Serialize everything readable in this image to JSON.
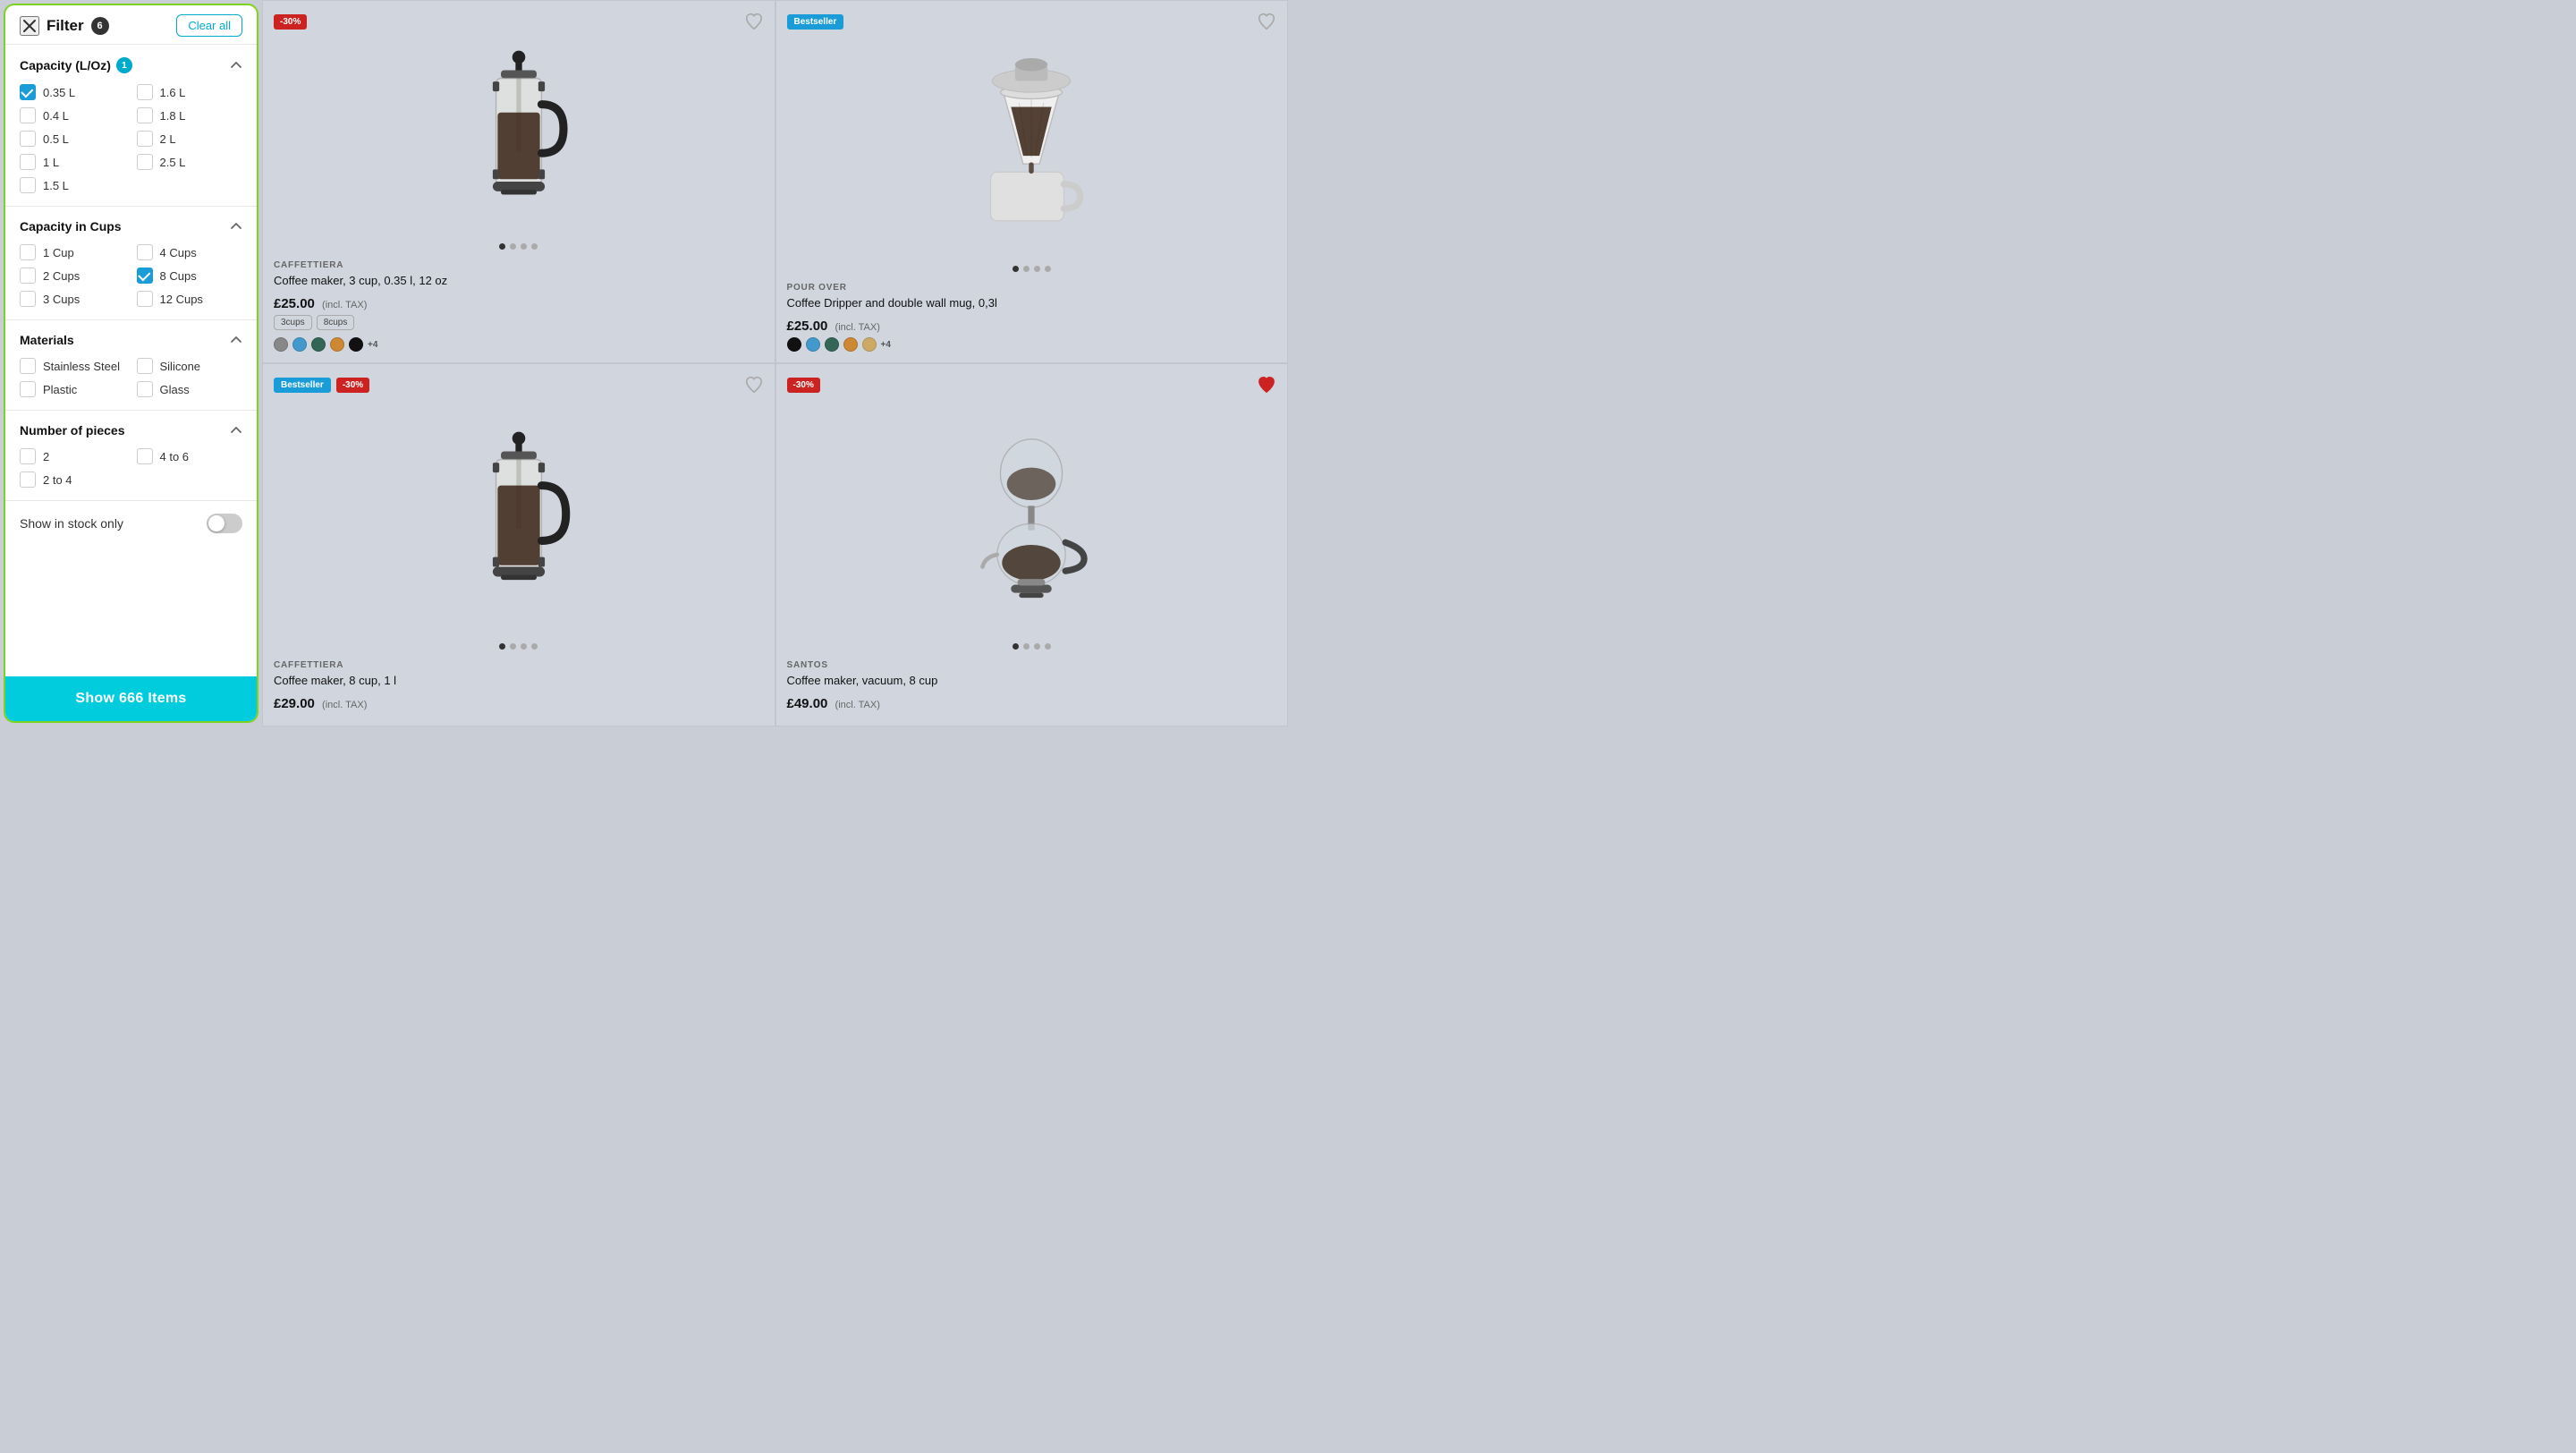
{
  "filter": {
    "title": "Filter",
    "badge": "6",
    "clear_all": "Clear all",
    "sections": [
      {
        "id": "capacity_l_oz",
        "title": "Capacity (L/Oz)",
        "badge": "1",
        "expanded": true,
        "options": [
          {
            "label": "0.35 L",
            "checked": true,
            "col": 0
          },
          {
            "label": "0.4 L",
            "checked": false,
            "col": 0
          },
          {
            "label": "0.5 L",
            "checked": false,
            "col": 0
          },
          {
            "label": "1 L",
            "checked": false,
            "col": 0
          },
          {
            "label": "1.5 L",
            "checked": false,
            "col": 0
          },
          {
            "label": "1.6 L",
            "checked": false,
            "col": 1
          },
          {
            "label": "1.8 L",
            "checked": false,
            "col": 1
          },
          {
            "label": "2 L",
            "checked": false,
            "col": 1
          },
          {
            "label": "2.5 L",
            "checked": false,
            "col": 1
          }
        ]
      },
      {
        "id": "capacity_cups",
        "title": "Capacity in Cups",
        "badge": null,
        "expanded": true,
        "options": [
          {
            "label": "1 Cup",
            "checked": false,
            "col": 0
          },
          {
            "label": "2 Cups",
            "checked": false,
            "col": 0
          },
          {
            "label": "3 Cups",
            "checked": false,
            "col": 0
          },
          {
            "label": "4 Cups",
            "checked": false,
            "col": 1
          },
          {
            "label": "8 Cups",
            "checked": true,
            "col": 1
          },
          {
            "label": "12 Cups",
            "checked": false,
            "col": 1
          }
        ]
      },
      {
        "id": "materials",
        "title": "Materials",
        "badge": null,
        "expanded": true,
        "options": [
          {
            "label": "Stainless Steel",
            "checked": false,
            "col": 0
          },
          {
            "label": "Plastic",
            "checked": false,
            "col": 0
          },
          {
            "label": "Silicone",
            "checked": false,
            "col": 1
          },
          {
            "label": "Glass",
            "checked": false,
            "col": 1
          }
        ]
      },
      {
        "id": "num_pieces",
        "title": "Number of pieces",
        "badge": null,
        "expanded": true,
        "options": [
          {
            "label": "2",
            "checked": false,
            "col": 0
          },
          {
            "label": "2 to 4",
            "checked": false,
            "col": 0
          },
          {
            "label": "4 to 6",
            "checked": false,
            "col": 1
          }
        ]
      }
    ],
    "show_in_stock": {
      "label": "Show in stock only",
      "enabled": false
    },
    "show_items_btn": "Show 666 Items"
  },
  "products": [
    {
      "id": 1,
      "category": "CAFFETTIERA",
      "name": "Coffee maker, 3 cup, 0.35 l, 12 oz",
      "price": "£25.00",
      "tax_note": "(incl. TAX)",
      "discount": "-30%",
      "bestseller": false,
      "size_tags": [
        "3cups",
        "8cups"
      ],
      "swatches": [
        "#888",
        "#4499cc",
        "#336655",
        "#cc8833",
        "#111"
      ],
      "swatch_more": "+4",
      "dots": 4,
      "active_dot": 0,
      "heart_filled": false,
      "out_of_stock_label": null
    },
    {
      "id": 2,
      "category": "POUR OVER",
      "name": "Coffee Dripper and double wall mug, 0,3l",
      "price": "£25.00",
      "tax_note": "(incl. TAX)",
      "discount": null,
      "bestseller": true,
      "size_tags": [],
      "swatches": [
        "#111",
        "#4499cc",
        "#336655",
        "#cc8833",
        "#ccaa66"
      ],
      "swatch_more": "+4",
      "dots": 4,
      "active_dot": 0,
      "heart_filled": false,
      "out_of_stock_label": null
    },
    {
      "id": 3,
      "category": "CAFFETTIERA",
      "name": "Coffee maker, 8 cup, 1 l",
      "price": "£29.00",
      "tax_note": "(incl. TAX)",
      "discount": "-30%",
      "bestseller": true,
      "size_tags": [],
      "swatches": [],
      "swatch_more": null,
      "dots": 4,
      "active_dot": 0,
      "heart_filled": false,
      "out_of_stock_label": null
    },
    {
      "id": 4,
      "category": "SANTOS",
      "name": "Coffee maker, vacuum, 8 cup",
      "price": "£49.00",
      "tax_note": "(incl. TAX)",
      "discount": "-30%",
      "bestseller": false,
      "size_tags": [],
      "swatches": [],
      "swatch_more": null,
      "dots": 4,
      "active_dot": 0,
      "heart_filled": true,
      "out_of_stock_label": null
    }
  ],
  "icons": {
    "close": "✕",
    "chevron_up": "chevron-up",
    "heart_empty": "♡",
    "heart_filled": "♥"
  }
}
